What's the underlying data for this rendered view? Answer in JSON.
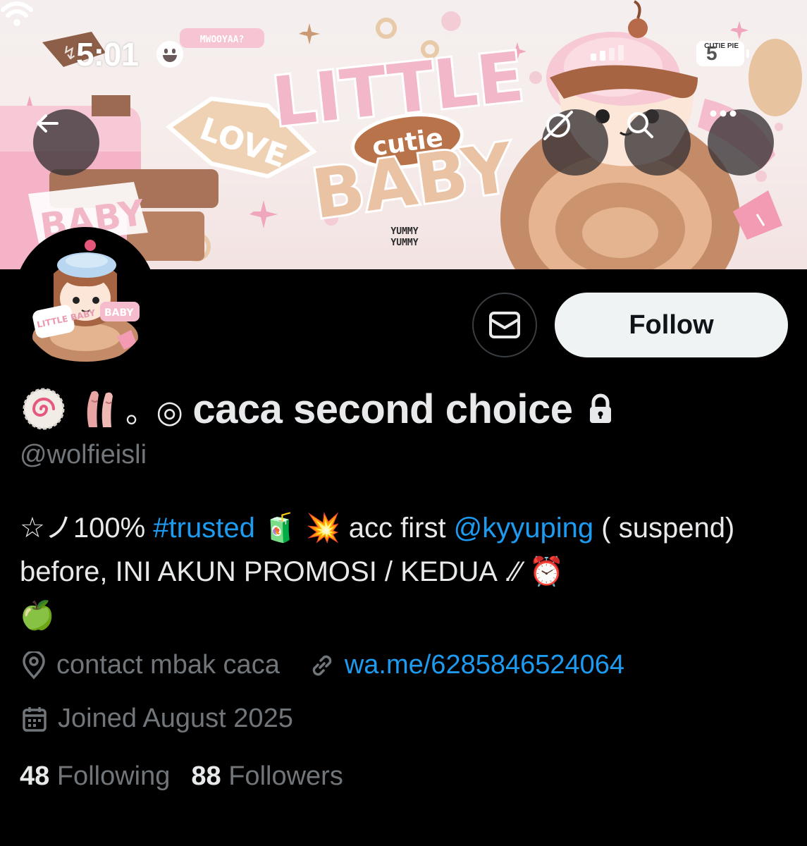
{
  "status_bar": {
    "time": "5:01",
    "battery": "5",
    "battery_sticker": "CUTIE PIE"
  },
  "banner": {
    "tag": "MWOOYAA?",
    "word_love": "LOVE",
    "title_line1": "LITTLE",
    "title_center": "cutie",
    "title_line2": "BABY",
    "word_baby_left": "BABY",
    "subtext1": "YUMMY",
    "subtext2": "YUMMY"
  },
  "nav": {
    "back_icon": "arrow-left-icon",
    "grok_icon": "grok-icon",
    "search_icon": "search-icon",
    "more_icon": "more-icon"
  },
  "avatar": {
    "badge_left": "LITTLE BABY",
    "badge_right": "BABY"
  },
  "actions": {
    "message_icon": "envelope-icon",
    "follow_label": "Follow"
  },
  "profile": {
    "name_prefix": "。◎",
    "display_name": "caca second choice",
    "lock_icon": "lock-icon",
    "handle": "@wolfieisli",
    "bio": {
      "part1": "☆ノ100% ",
      "hashtag": "#trusted",
      "part2": " 🧃  💥 acc first ",
      "mention": "@kyyuping",
      "part3": " ( suspend) before, INI AKUN PROMOSI / KEDUA .⁄⁄ ⏰",
      "part4": "🍏"
    },
    "location": "contact mbak caca",
    "website": "wa.me/6285846524064",
    "joined": "Joined August 2025",
    "following_count": "48",
    "following_label": "Following",
    "followers_count": "88",
    "followers_label": "Followers"
  },
  "colors": {
    "background": "#000000",
    "accent": "#1d9bf0",
    "muted": "#71767b",
    "text": "#e7e9ea"
  }
}
